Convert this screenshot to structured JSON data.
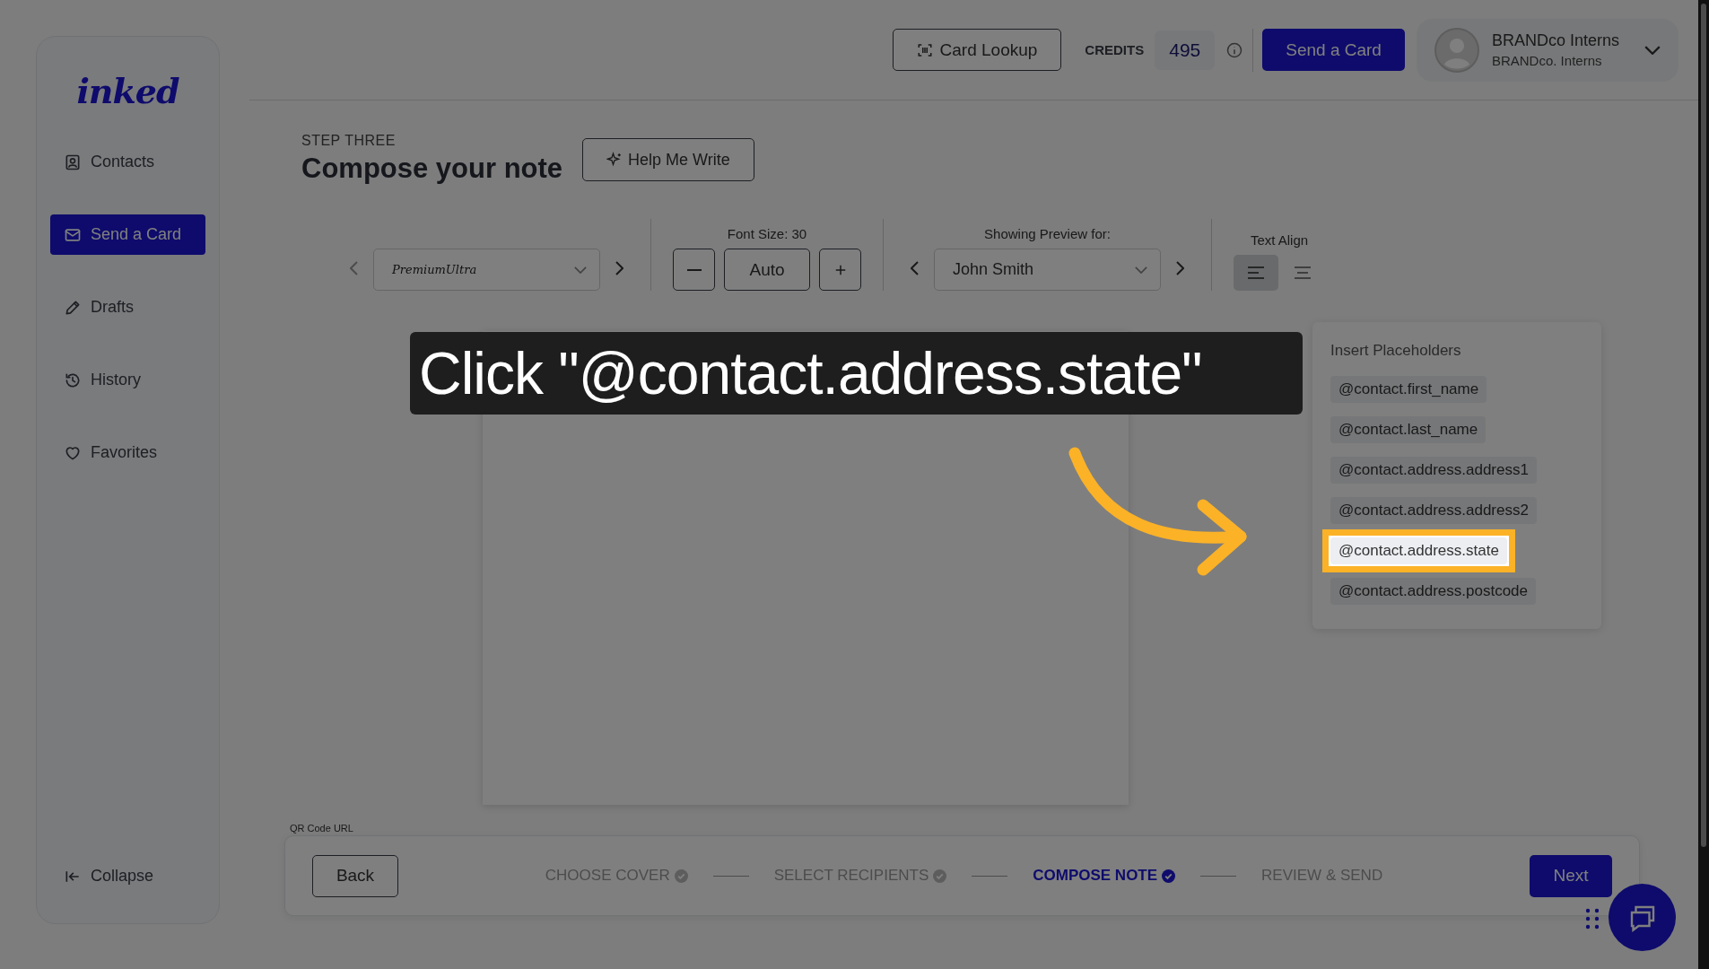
{
  "sidebar": {
    "logo": "inked",
    "items": [
      {
        "label": "Contacts",
        "kind": "contacts",
        "selected": false
      },
      {
        "label": "Send a Card",
        "kind": "mail",
        "selected": true
      },
      {
        "label": "Drafts",
        "kind": "pencil",
        "selected": false
      },
      {
        "label": "History",
        "kind": "history",
        "selected": false
      },
      {
        "label": "Favorites",
        "kind": "heart",
        "selected": false
      }
    ],
    "collapse": "Collapse"
  },
  "header": {
    "card_lookup": "Card Lookup",
    "credits_label": "CREDITS",
    "credits": "495",
    "send_button": "Send a Card",
    "user": {
      "name": "BRANDco Interns",
      "org": "BRANDco. Interns"
    }
  },
  "compose": {
    "step": "STEP THREE",
    "title": "Compose your note",
    "help_button": "Help Me Write",
    "font_select": "PremiumUltra",
    "font_size_label": "Font Size: 30",
    "font_size_value": "Auto",
    "preview_label": "Showing Preview for:",
    "preview_contact": "John Smith",
    "align_label": "Text Align",
    "align": [
      {
        "kind": "left",
        "selected": true
      },
      {
        "kind": "center",
        "selected": false
      }
    ]
  },
  "qr_label": "QR Code URL",
  "placeholders": {
    "title": "Insert Placeholders",
    "items": [
      {
        "label": "@contact.first_name",
        "highlighted": false
      },
      {
        "label": "@contact.last_name",
        "highlighted": false
      },
      {
        "label": "@contact.address.address1",
        "highlighted": false
      },
      {
        "label": "@contact.address.address2",
        "highlighted": false
      },
      {
        "label": "@contact.address.state",
        "highlighted": true
      },
      {
        "label": "@contact.address.postcode",
        "highlighted": false
      }
    ]
  },
  "steps": {
    "back": "Back",
    "items": [
      {
        "label": "CHOOSE COVER",
        "done": true,
        "selected": false
      },
      {
        "label": "SELECT RECIPIENTS",
        "done": true,
        "selected": false
      },
      {
        "label": "COMPOSE NOTE",
        "done": true,
        "selected": true
      },
      {
        "label": "REVIEW & SEND",
        "done": false,
        "selected": false
      }
    ],
    "next": "Next"
  },
  "callout": {
    "text": "Click \"@contact.address.state\""
  }
}
